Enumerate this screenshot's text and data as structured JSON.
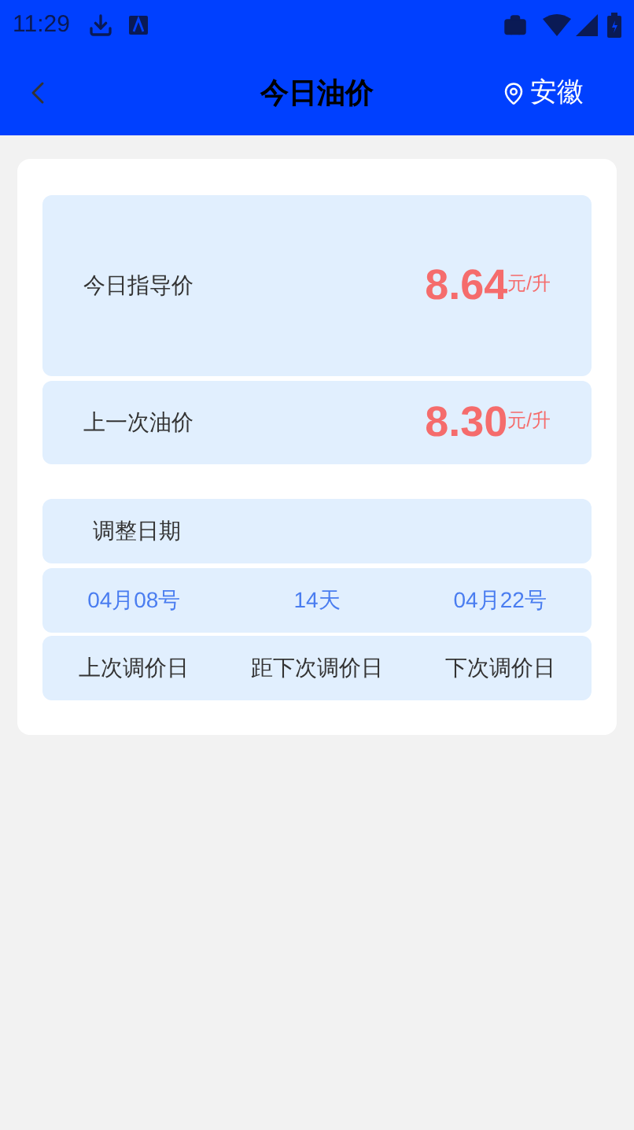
{
  "status_bar": {
    "time": "11:29"
  },
  "header": {
    "title": "今日油价",
    "location": "安徽"
  },
  "prices": [
    {
      "label": "今日指导价",
      "value": "8.64",
      "unit": "元/升",
      "kind": "main"
    },
    {
      "label": "上一次油价",
      "value": "8.30",
      "unit": "元/升",
      "kind": "previous"
    }
  ],
  "adjustment": {
    "title": "调整日期",
    "values": [
      "04月08号",
      "14天",
      "04月22号"
    ],
    "labels": [
      "上次调价日",
      "距下次调价日",
      "下次调价日"
    ]
  }
}
